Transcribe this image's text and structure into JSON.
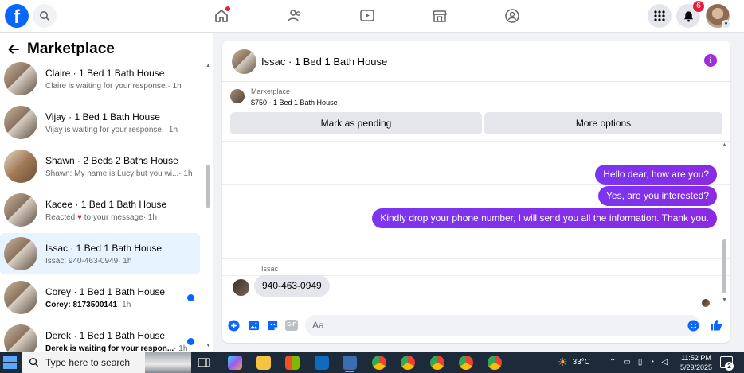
{
  "topbar": {
    "logo": "f",
    "notification_count": "6",
    "nav_icons": [
      "home-icon",
      "friends-icon",
      "video-icon",
      "marketplace-icon",
      "groups-icon"
    ]
  },
  "sidebar": {
    "title": "Marketplace",
    "conversations": [
      {
        "name": "Claire · 1 Bed 1 Bath House",
        "preview": "Claire is waiting for your response.",
        "time": "· 1h",
        "unread": false,
        "bold": false
      },
      {
        "name": "Vijay · 1 Bed 1 Bath House",
        "preview": "Vijay is waiting for your response.",
        "time": "· 1h",
        "unread": false,
        "bold": false
      },
      {
        "name": "Shawn · 2 Beds 2 Baths House",
        "preview": "Shawn: My name is Lucy but you wi...",
        "time": "· 1h",
        "unread": false,
        "bold": false
      },
      {
        "name": "Kacee · 1 Bed 1 Bath House",
        "preview_before": "Reacted",
        "preview_after": "to your message",
        "time": "· 1h",
        "unread": false,
        "bold": false
      },
      {
        "name": "Issac · 1 Bed 1 Bath House",
        "preview": "Issac: 940-463-0949",
        "time": "· 1h",
        "unread": false,
        "bold": false,
        "active": true
      },
      {
        "name": "Corey · 1 Bed 1 Bath House",
        "preview": "Corey: 8173500141",
        "time": "· 1h",
        "unread": true,
        "bold": true
      },
      {
        "name": "Derek · 1 Bed 1 Bath House",
        "preview": "Derek is waiting for your respon...",
        "time": "· 1h",
        "unread": true,
        "bold": true
      }
    ]
  },
  "chat": {
    "title": "Issac · 1 Bed 1 Bath House",
    "listing_label": "Marketplace",
    "listing_price": "$750 - 1 Bed 1 Bath House",
    "mark_pending_label": "Mark as pending",
    "more_options_label": "More options",
    "outgoing": [
      "Hello dear, how are you?",
      "Yes, are you interested?",
      "Kindly drop your phone number, I will send you all the information. Thank you."
    ],
    "sender": "Issac",
    "incoming": "940-463-0949",
    "composer_placeholder": "Aa",
    "gif_label": "GIF"
  },
  "taskbar": {
    "search_placeholder": "Type here to search",
    "temperature": "33°C",
    "time": "11:52 PM",
    "date": "5/29/2025",
    "notification_count": "2"
  },
  "colors": {
    "brand": "#0866ff",
    "outgoing_bubble": "#7c2cf4",
    "badge": "#e41e3f",
    "info": "#9b2fd9"
  }
}
